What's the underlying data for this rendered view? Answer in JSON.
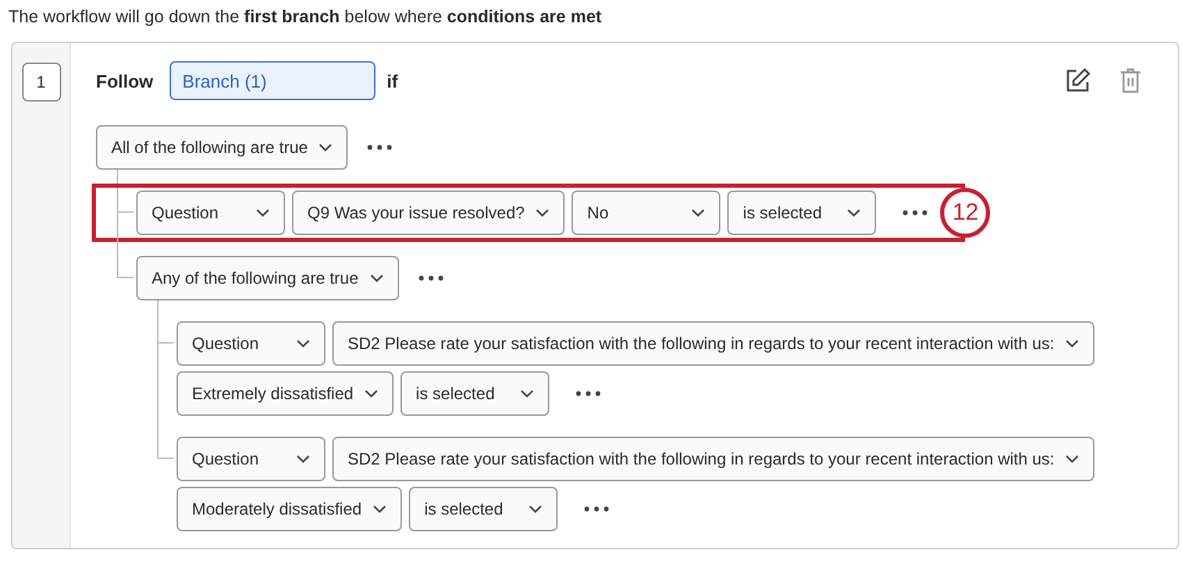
{
  "intro": "The workflow will go down the **first branch** below where **conditions are met**",
  "branch": {
    "number": "1",
    "follow_label": "Follow",
    "name_value": "Branch (1)",
    "if_label": "if",
    "root_group": {
      "label": "All of the following are true",
      "children": [
        {
          "kind": "condition",
          "highlighted": true,
          "badge": "12",
          "dropdowns": [
            "Question",
            "Q9 Was your issue resolved?",
            "No",
            "is selected"
          ]
        },
        {
          "kind": "group",
          "label": "Any of the following are true",
          "children": [
            {
              "kind": "condition",
              "dropdowns": [
                "Question",
                "SD2 Please rate your satisfaction with the following in regards to your recent interaction with us:",
                "Extremely dissatisfied",
                "is selected"
              ]
            },
            {
              "kind": "condition",
              "dropdowns": [
                "Question",
                "SD2 Please rate your satisfaction with the following in regards to your recent interaction with us:",
                "Moderately dissatisfied",
                "is selected"
              ]
            }
          ]
        }
      ]
    }
  }
}
